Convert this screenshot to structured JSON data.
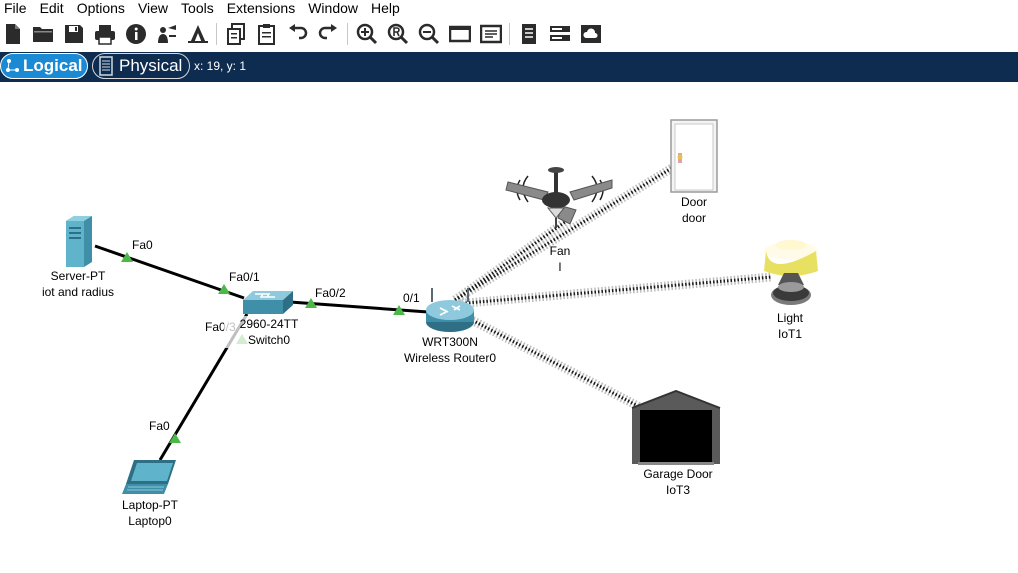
{
  "menu": [
    "File",
    "Edit",
    "Options",
    "View",
    "Tools",
    "Extensions",
    "Window",
    "Help"
  ],
  "toolbar_icons": [
    "new-file-icon",
    "open-folder-icon",
    "save-icon",
    "print-icon",
    "info-icon",
    "network-wizard-icon",
    "activity-wizard-icon",
    "copy-icon",
    "paste-icon",
    "undo-icon",
    "redo-icon",
    "zoom-in-icon",
    "zoom-reset-icon",
    "zoom-out-icon",
    "drawing-palette-icon",
    "custom-device-dialog-icon",
    "report-icon",
    "ipc-icon",
    "cloud-icon"
  ],
  "mode_bar": {
    "logical_label": "Logical",
    "physical_label": "Physical",
    "coordinates": "x: 19, y: 1"
  },
  "colors": {
    "mode_bar_bg": "#0d2c4f",
    "logical_active": "#1a8ad4",
    "port_indicator": "#4cb848"
  },
  "devices": {
    "server": {
      "type": "Server-PT",
      "name": "iot and radius"
    },
    "switch": {
      "type": "2960-24TT",
      "name": "Switch0"
    },
    "router": {
      "type": "WRT300N",
      "name": "Wireless Router0"
    },
    "laptop": {
      "type": "Laptop-PT",
      "name": "Laptop0"
    },
    "fan": {
      "type": "Fan",
      "name": "l"
    },
    "door": {
      "type": "Door",
      "name": "door"
    },
    "light": {
      "type": "Light",
      "name": "IoT1"
    },
    "garage": {
      "type": "Garage Door",
      "name": "IoT3"
    }
  },
  "ports": {
    "server_fa0": "Fa0",
    "switch_fa0_1": "Fa0/1",
    "switch_fa0_2": "Fa0/2",
    "switch_fa0_3": "Fa0/3",
    "router_port": "0/1",
    "laptop_fa0": "Fa0"
  }
}
